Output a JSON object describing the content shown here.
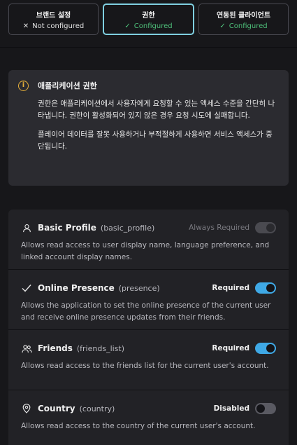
{
  "tabs": [
    {
      "title": "브랜드 설정",
      "status": "Not configured",
      "mark": "✕",
      "state": "no"
    },
    {
      "title": "권한",
      "status": "Configured",
      "mark": "✓",
      "state": "ok"
    },
    {
      "title": "연동된 클라이언트",
      "status": "Configured",
      "mark": "✓",
      "state": "ok"
    }
  ],
  "notice": {
    "icon": "info-icon",
    "title": "애플리케이션 권한",
    "paragraph1": "권한은 애플리케이션에서 사용자에게 요청할 수 있는 액세스 수준을 간단히 나타냅니다. 권한이 활성화되어 있지 않은 경우 요청 시도에 실패합니다.",
    "paragraph2": "플레이어 데이터를 잘못 사용하거나 부적절하게 사용하면 서비스 액세스가 중단됩니다."
  },
  "permissions": [
    {
      "name": "Basic Profile",
      "scope": "(basic_profile)",
      "status": "Always Required",
      "icon": "user-icon",
      "description": "Allows read access to user display name, language preference, and linked account display names."
    },
    {
      "name": "Online Presence",
      "scope": "(presence)",
      "status": "Required",
      "icon": "checkmark-icon",
      "description": "Allows the application to set the online presence of the current user and receive online presence updates from their friends."
    },
    {
      "name": "Friends",
      "scope": "(friends_list)",
      "status": "Required",
      "icon": "users-icon",
      "description": "Allows read access to the friends list for the current user's account."
    },
    {
      "name": "Country",
      "scope": "(country)",
      "status": "Disabled",
      "icon": "location-pin-icon",
      "description": "Allows read access to the country of the current user's account."
    }
  ],
  "colors": {
    "accent": "#3fa9e6",
    "ok": "#4ec07a",
    "warning": "#e8b13a"
  }
}
